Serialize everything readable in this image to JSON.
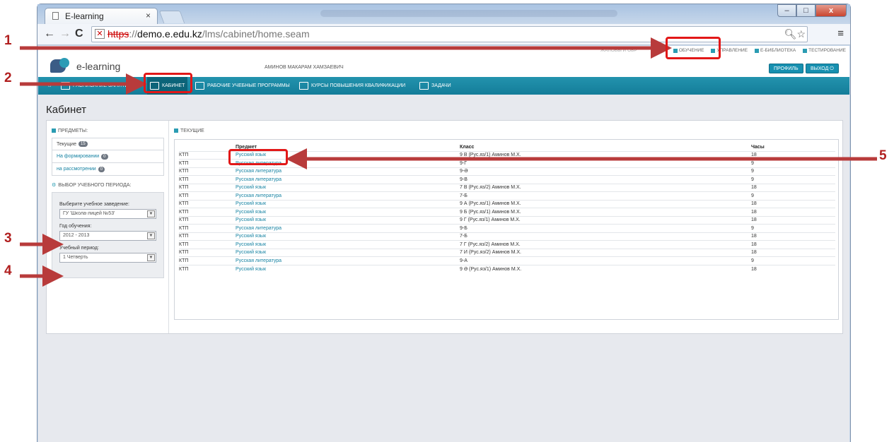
{
  "browser": {
    "tab_title": "E-learning",
    "tab_close": "×",
    "url_scheme": "https",
    "url_sep": "://",
    "url_domain": "demo.e.edu.kz",
    "url_path": "/lms/cabinet/home.seam",
    "nav": {
      "back": "←",
      "forward": "→",
      "reload": "C"
    },
    "window_buttons": {
      "minimize": "–",
      "maximize": "□",
      "close": "x"
    }
  },
  "header": {
    "logo_text": "e-learning",
    "user_name": "АМИНОВ МАКАРАМ ХАМЗАЕВИЧ",
    "top_nav": {
      "faded": "ЖАЛОБЫ И ОБР",
      "items": [
        "ОБУЧЕНИЕ",
        "УПРАВЛЕНИЕ",
        "Е-БИБЛИОТЕКА",
        "ТЕСТИРОВАНИЕ"
      ]
    },
    "profile_label": "ПРОФИЛЬ",
    "logout_label": "ВЫХОД"
  },
  "main_menu": {
    "schedule": "РАСПИСАНИЕ ЗАНЯТИЙ",
    "cabinet": "КАБИНЕТ",
    "programs": "РАБОЧИЕ УЧЕБНЫЕ ПРОГРАММЫ",
    "courses": "КУРСЫ ПОВЫШЕНИЯ КВАЛИФИКАЦИИ",
    "tasks": "ЗАДАЧИ"
  },
  "page_title": "Кабинет",
  "left_panel": {
    "subjects_label": "ПРЕДМЕТЫ:",
    "items": [
      {
        "label": "Текущие",
        "count": "15"
      },
      {
        "label": "На формировании",
        "count": "0"
      },
      {
        "label": "на рассмотрении",
        "count": "0"
      }
    ],
    "period_label": "ВЫБОР УЧЕБНОГО ПЕРИОДА:",
    "school_label": "Выберите учебное заведение:",
    "school_value": "ГУ 'Школа-лицей №53'",
    "year_label": "Год обучения:",
    "year_value": "2012 - 2013",
    "period_field_label": "Учебный период:",
    "period_value": "1 Четверть"
  },
  "current_section": {
    "label": "ТЕКУЩИЕ",
    "columns": [
      "",
      "Предмет",
      "Класс",
      "Часы"
    ],
    "rows": [
      [
        "КТП",
        "Русский язык",
        "9 В (Рус.яз/1) Аминов М.Х.",
        "18"
      ],
      [
        "КТП",
        "Русская литература",
        "9-Г",
        "9"
      ],
      [
        "КТП",
        "Русская литература",
        "9-Ә",
        "9"
      ],
      [
        "КТП",
        "Русская литература",
        "9-В",
        "9"
      ],
      [
        "КТП",
        "Русский язык",
        "7 В (Рус.яз/2) Аминов М.Х.",
        "18"
      ],
      [
        "КТП",
        "Русская литература",
        "7-Б",
        "9"
      ],
      [
        "КТП",
        "Русский язык",
        "9 А (Рус.яз/1) Аминов М.Х.",
        "18"
      ],
      [
        "КТП",
        "Русский язык",
        "9 Б (Рус.яз/1) Аминов М.Х.",
        "18"
      ],
      [
        "КТП",
        "Русский язык",
        "9 Г (Рус.яз/1) Аминов М.Х.",
        "18"
      ],
      [
        "КТП",
        "Русская литература",
        "9-Б",
        "9"
      ],
      [
        "КТП",
        "Русский язык",
        "7-Б",
        "18"
      ],
      [
        "КТП",
        "Русский язык",
        "7 Г (Рус.яз/2) Аминов М.Х.",
        "18"
      ],
      [
        "КТП",
        "Русский язык",
        "7 И (Рус.яз/2) Аминов М.Х.",
        "18"
      ],
      [
        "КТП",
        "Русская литература",
        "9-А",
        "9"
      ],
      [
        "КТП",
        "Русский язык",
        "9 Ә (Рус.яз/1) Аминов М.Х.",
        "18"
      ]
    ]
  },
  "annotations": {
    "n1": "1",
    "n2": "2",
    "n3": "3",
    "n4": "4",
    "n5": "5"
  },
  "colors": {
    "accent": "#1790b0",
    "menu_bg": "#147d99",
    "annotation": "#e21818"
  }
}
